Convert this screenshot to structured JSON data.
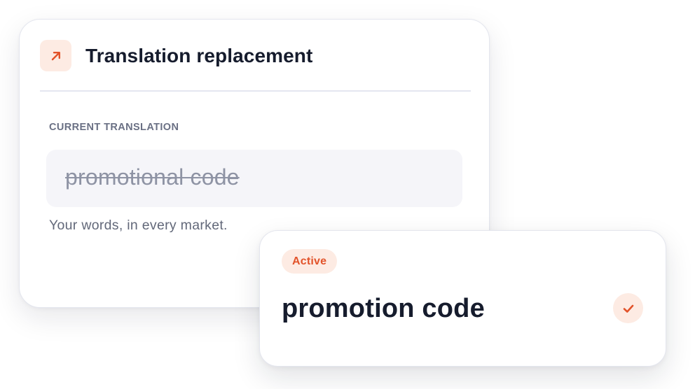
{
  "colors": {
    "accent": "#e2532a",
    "accent_soft": "#fdebe3",
    "text_dark": "#161c2d",
    "text_muted": "#6a7084"
  },
  "replacement_card": {
    "icon": "arrow-up-right-icon",
    "title": "Translation replacement",
    "current_label": "CURRENT TRANSLATION",
    "current_value": "promotional code",
    "tagline": "Your words, in every market."
  },
  "new_translation_card": {
    "status_badge": "Active",
    "value": "promotion code",
    "icon": "check-icon"
  }
}
